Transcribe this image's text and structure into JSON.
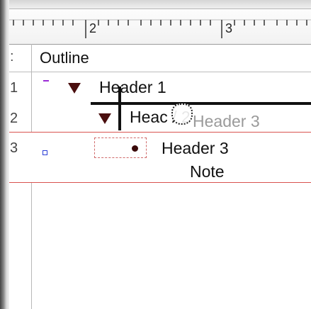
{
  "ruler": {
    "marks": [
      "2",
      "3"
    ]
  },
  "outline": {
    "column_header": "Outline",
    "rows": [
      {
        "number": "1",
        "text": "Header 1"
      },
      {
        "number": "2",
        "text": "Heac  / 2"
      },
      {
        "number": "3",
        "text": "Header 3",
        "note": "Note"
      }
    ],
    "drag_ghost_text": "Header 3"
  },
  "colors": {
    "triangle": "#4a0e0e",
    "selection_border": "#d9534f",
    "square_marker": "#2b3fd6",
    "dash_marker": "#9b2bd6"
  }
}
